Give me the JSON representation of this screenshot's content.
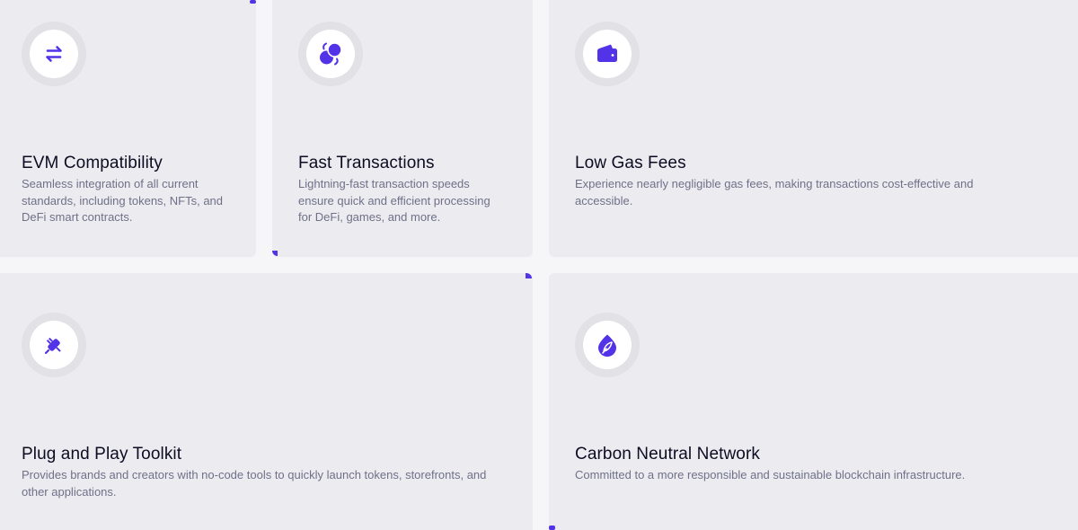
{
  "colors": {
    "accent": "#5233e8",
    "card_bg": "#ececf0",
    "title": "#0d0c22",
    "description": "#6f7088",
    "icon_ring": "#e1e1e6"
  },
  "features": [
    {
      "icon": "swap-arrows-icon",
      "title": "EVM Compatibility",
      "description": "Seamless integration of all current standards, including tokens, NFTs, and DeFi smart contracts."
    },
    {
      "icon": "circles-exchange-icon",
      "title": "Fast Transactions",
      "description": "Lightning-fast transaction speeds ensure quick and efficient processing for DeFi, games, and more."
    },
    {
      "icon": "wallet-icon",
      "title": "Low Gas Fees",
      "description": "Experience nearly negligible gas fees, making transactions cost-effective and accessible."
    },
    {
      "icon": "plug-icon",
      "title": "Plug and Play Toolkit",
      "description": "Provides brands and creators with no-code tools to quickly launch tokens, storefronts, and other applications."
    },
    {
      "icon": "leaf-drop-icon",
      "title": "Carbon Neutral Network",
      "description": "Committed to a more responsible and sustainable blockchain infrastructure."
    }
  ]
}
